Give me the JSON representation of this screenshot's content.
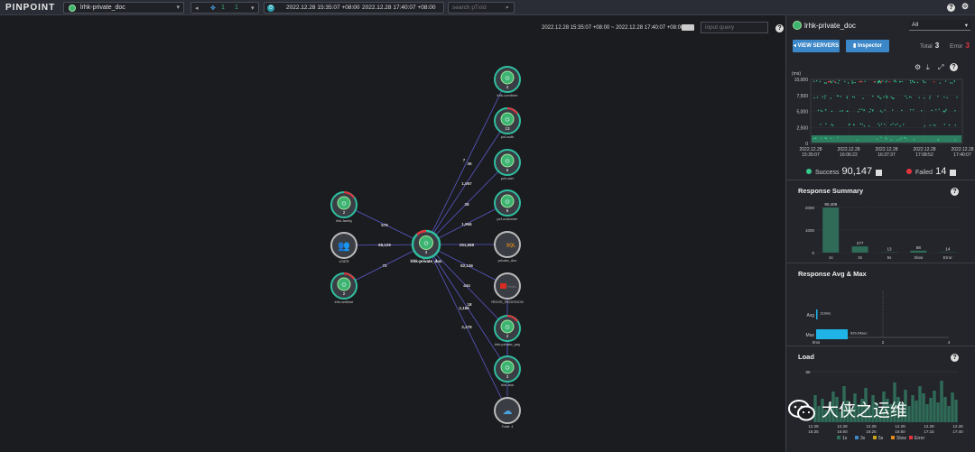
{
  "topbar": {
    "logo": "PINPOINT",
    "app_name": "lrhk-private_doc",
    "filter_counts": [
      "1",
      "1"
    ],
    "time_from": "2022.12.28 15:35:07 +08:00",
    "time_sep": "~",
    "time_to": "2022.12.28 17:40:07 +08:00",
    "search_placeholder": "search pTxId"
  },
  "map": {
    "range_text": "2022.12.28 15:35:07 +08:00 ~ 2022.12.28 17:40:07 +08:00",
    "query_placeholder": "input query",
    "nodes": {
      "left1": "lrhk-family",
      "users": "USER",
      "left3": "lrhk-welfare",
      "center": "lrhk-private_doc",
      "r1": "lrhk-combine",
      "r2": "pcf-auth",
      "r3": "pcf-user",
      "r4": "pcf-customer",
      "sql": "private_doc",
      "redis": "REDIS_REDISSON",
      "r7": "lrhk-private_pay",
      "r8": "lrhk-bss",
      "total": "Total: 4",
      "sql_label": "SQL",
      "redis_label": "Redis"
    },
    "node_counts": {
      "left1": "2",
      "left3": "2",
      "center": "3",
      "r1": "2",
      "r2": "13",
      "r3": "5",
      "r4": "9",
      "r7": "2",
      "r8": "3"
    },
    "edges": {
      "l1": "576",
      "users": "88,129",
      "l3": "72",
      "r1": "7",
      "r2": "35",
      "r3": "1,067",
      "r4": "28",
      "r4b": "1,966",
      "sql": "251,588",
      "redis": "82,136",
      "r7": "444",
      "r7b": "18",
      "r8": "2,186",
      "total": "2,478"
    }
  },
  "panel": {
    "title": "lrhk-private_doc",
    "agent_select": "All",
    "view_servers": "VIEW SERVERS",
    "inspector": "Inspector",
    "total_label": "Total",
    "total_value": "3",
    "error_label": "Error",
    "error_value": "3",
    "scatter": {
      "ylabel": "(ms)",
      "y_ticks": [
        "10,000",
        "7,500",
        "5,000",
        "2,500",
        "0"
      ],
      "x_ticks": [
        [
          "2022.12.28",
          "15:35:07"
        ],
        [
          "2022.12.28",
          "16:06:22"
        ],
        [
          "2022.12.28",
          "16:37:37"
        ],
        [
          "2022.12.28",
          "17:08:52"
        ],
        [
          "2022.12.28",
          "17:40:07"
        ]
      ],
      "success_label": "Success",
      "success_value": "90,147",
      "failed_label": "Failed",
      "failed_value": "14"
    },
    "response_summary": {
      "title": "Response Summary"
    },
    "response_avg_max": {
      "title": "Response Avg & Max",
      "avg_label": "Avg",
      "avg_value": "119ms",
      "max_label": "Max",
      "max_value": "929.24sec",
      "x_ticks": [
        "0ms",
        "2",
        "4"
      ]
    },
    "load": {
      "title": "Load",
      "y_tick": "8K",
      "x_ticks": [
        [
          "12.28",
          "15:35"
        ],
        [
          "12.28",
          "16:00"
        ],
        [
          "12.28",
          "16:25"
        ],
        [
          "12.28",
          "16:50"
        ],
        [
          "12.28",
          "17:15"
        ],
        [
          "12.28",
          "17:40"
        ]
      ],
      "legend": [
        "1s",
        "3s",
        "5s",
        "Slow",
        "Error"
      ]
    }
  },
  "watermark": "大侠之运维",
  "colors": {
    "success": "#37c98c",
    "failed": "#e5343e",
    "bar": "#2f6b57",
    "avgmax": "#1fb3e8",
    "accent_blue": "#3b87c8"
  },
  "chart_data": [
    {
      "type": "bar",
      "title": "Response Summary",
      "categories": [
        "1s",
        "3s",
        "5s",
        "Slow",
        "Error"
      ],
      "values": [
        90409,
        277,
        13,
        88,
        14
      ],
      "y_ticks": [
        "2000",
        "1000",
        "0"
      ],
      "ylim": [
        0,
        2000
      ]
    },
    {
      "type": "bar",
      "title": "Response Avg & Max",
      "categories": [
        "Avg",
        "Max"
      ],
      "values": [
        0.119,
        929.24
      ],
      "labels": [
        "119ms",
        "929.24sec"
      ]
    }
  ]
}
